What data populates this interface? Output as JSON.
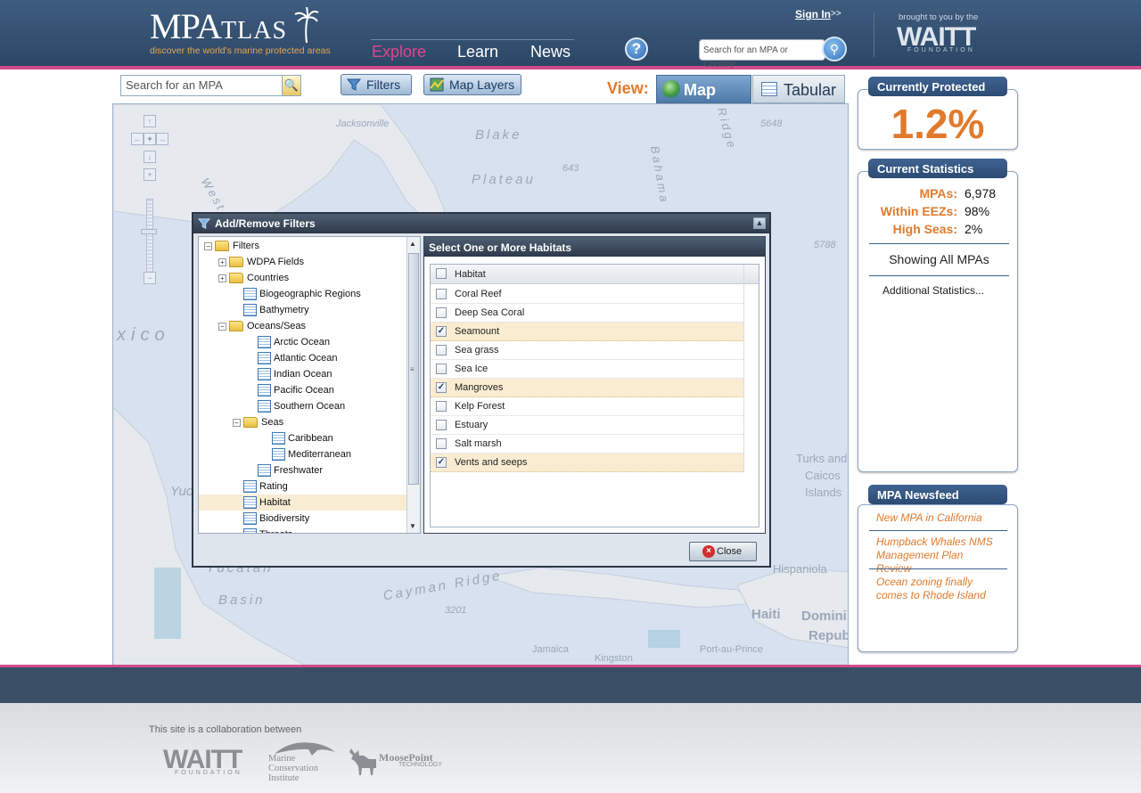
{
  "header": {
    "logo_main": "MPA",
    "logo_sub": "TLAS",
    "tagline": "discover the world's marine protected areas",
    "nav": [
      "Explore",
      "Learn",
      "News"
    ],
    "help_label": "?",
    "signin": "Sign In",
    "signin_arrow": ">>",
    "search_placeholder": "Search for an MPA or Country",
    "brought_by": "brought to you by the",
    "sponsor": "WAITT",
    "sponsor_sub": "FOUNDATION"
  },
  "toolbar": {
    "search_placeholder": "Search for an MPA",
    "filters_label": "Filters",
    "layers_label": "Map Layers",
    "view_label": "View:",
    "view_map": "Map",
    "view_tabular": "Tabular"
  },
  "map_labels": {
    "jacksonville": "Jacksonville",
    "blake": "Blake",
    "plateau": "Plateau",
    "ridge": "Ridge",
    "bahama": "Bahama",
    "n5648": "5648",
    "n643": "643",
    "n5788": "5788",
    "west": "West",
    "mexico": "xico",
    "turks1": "Turks and",
    "turks2": "Caicos",
    "turks3": "Islands",
    "hispaniola": "Hispaniola",
    "haiti": "Haiti",
    "domin": "Domini",
    "repub": "Repub",
    "cayman": "Cayman Ridge",
    "n3201": "3201",
    "basin": "Basin",
    "yucatan": "Yucatan",
    "yuc": "Yuc",
    "jamaica": "Jamaica",
    "kingston": "Kingston",
    "portauprince": "Port-au-Prince"
  },
  "dialog": {
    "title": "Add/Remove Filters",
    "tree": [
      {
        "label": "Filters",
        "kind": "folder",
        "level": 0,
        "toggle": "−"
      },
      {
        "label": "WDPA Fields",
        "kind": "folder",
        "level": 1,
        "toggle": "+"
      },
      {
        "label": "Countries",
        "kind": "folder",
        "level": 1,
        "toggle": "+"
      },
      {
        "label": "Biogeographic Regions",
        "kind": "table",
        "level": 1
      },
      {
        "label": "Bathymetry",
        "kind": "table",
        "level": 1
      },
      {
        "label": "Oceans/Seas",
        "kind": "folder",
        "level": 1,
        "toggle": "−"
      },
      {
        "label": "Arctic Ocean",
        "kind": "table",
        "level": 2
      },
      {
        "label": "Atlantic Ocean",
        "kind": "table",
        "level": 2
      },
      {
        "label": "Indian Ocean",
        "kind": "table",
        "level": 2
      },
      {
        "label": "Pacific Ocean",
        "kind": "table",
        "level": 2
      },
      {
        "label": "Southern Ocean",
        "kind": "table",
        "level": 2
      },
      {
        "label": "Seas",
        "kind": "folder",
        "level": 2,
        "toggle": "−"
      },
      {
        "label": "Caribbean",
        "kind": "table",
        "level": 3
      },
      {
        "label": "Mediterranean",
        "kind": "table",
        "level": 3
      },
      {
        "label": "Freshwater",
        "kind": "table",
        "level": 2
      },
      {
        "label": "Rating",
        "kind": "table",
        "level": 1
      },
      {
        "label": "Habitat",
        "kind": "table",
        "level": 1,
        "selected": true
      },
      {
        "label": "Biodiversity",
        "kind": "table",
        "level": 1
      },
      {
        "label": "Threats",
        "kind": "table",
        "level": 1
      }
    ],
    "panel_title": "Select One or More Habitats",
    "column_header": "Habitat",
    "habitats": [
      {
        "label": "Coral Reef",
        "checked": false
      },
      {
        "label": "Deep Sea Coral",
        "checked": false
      },
      {
        "label": "Seamount",
        "checked": true
      },
      {
        "label": "Sea grass",
        "checked": false
      },
      {
        "label": "Sea Ice",
        "checked": false
      },
      {
        "label": "Mangroves",
        "checked": true
      },
      {
        "label": "Kelp Forest",
        "checked": false
      },
      {
        "label": "Estuary",
        "checked": false
      },
      {
        "label": "Salt marsh",
        "checked": false
      },
      {
        "label": "Vents and seeps",
        "checked": true
      }
    ],
    "close_label": "Close"
  },
  "sidebar": {
    "protected_title": "Currently Protected",
    "protected_value": "1.2%",
    "stats_title": "Current Statistics",
    "stats": [
      {
        "key": "MPAs:",
        "value": "6,978"
      },
      {
        "key": "Within EEZs:",
        "value": "98%"
      },
      {
        "key": "High Seas:",
        "value": "2%"
      }
    ],
    "showing": "Showing All MPAs",
    "additional": "Additional Statistics...",
    "news_title": "MPA Newsfeed",
    "news": [
      "New MPA in California",
      "Humpback Whales NMS Management Plan Review",
      "Ocean zoning finally comes to Rhode Island"
    ]
  },
  "footer": {
    "collab": "This site is a collaboration between",
    "org1": "WAITT",
    "org1_sub": "FOUNDATION",
    "org2_line1": "Marine",
    "org2_line2": "Conservation",
    "org2_line3": "Institute",
    "org3": "MoosePoint",
    "org3_sub": "TECHNOLOGY"
  },
  "colors": {
    "header": "#2c4766",
    "accent_pink": "#d14a8b",
    "accent_orange": "#e07a2c",
    "panel_title": "#3f6391"
  }
}
